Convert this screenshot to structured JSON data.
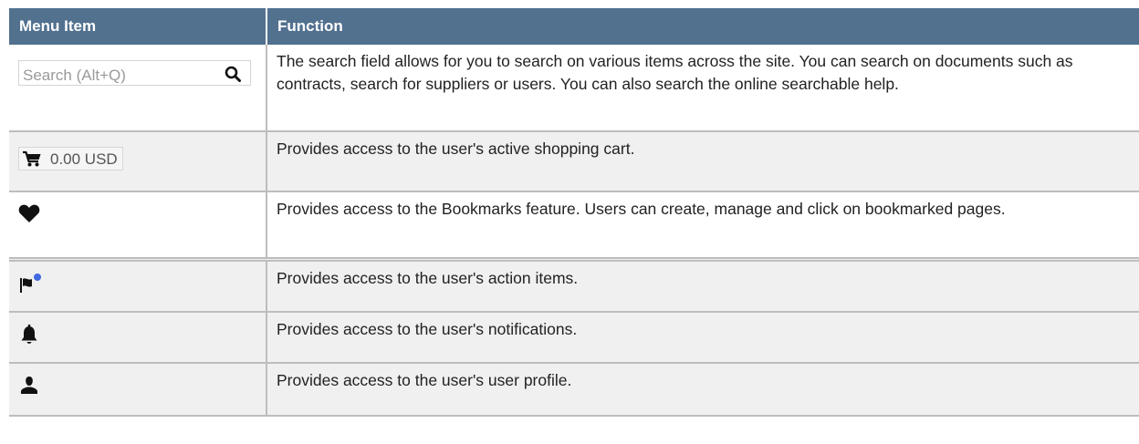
{
  "table": {
    "headers": [
      "Menu Item",
      "Function"
    ],
    "rows": [
      {
        "item": {
          "type": "search-field",
          "placeholder": "Search (Alt+Q)",
          "icon": "search-icon"
        },
        "function": "The search field allows for you to search on various items across the site. You can search on documents such as contracts, search for suppliers or users. You can also search the online searchable help."
      },
      {
        "item": {
          "type": "cart",
          "amount": "0.00 USD",
          "icon": "shopping-cart-icon"
        },
        "function": "Provides access to the user's active shopping cart."
      },
      {
        "item": {
          "type": "icon",
          "icon": "heart-icon"
        },
        "function": "Provides access to the Bookmarks feature. Users can create, manage and click on bookmarked pages."
      },
      {
        "item": {
          "type": "icon",
          "icon": "flag-icon"
        },
        "function": "Provides access to the user's action items."
      },
      {
        "item": {
          "type": "icon",
          "icon": "bell-icon"
        },
        "function": "Provides access to the user's notifications."
      },
      {
        "item": {
          "type": "icon",
          "icon": "user-icon"
        },
        "function": "Provides access to the user's user profile."
      }
    ]
  },
  "colors": {
    "header_bg": "#52718f",
    "header_text": "#ffffff",
    "alt_row_bg": "#f0f0f0",
    "notification_dot": "#4169e1"
  }
}
